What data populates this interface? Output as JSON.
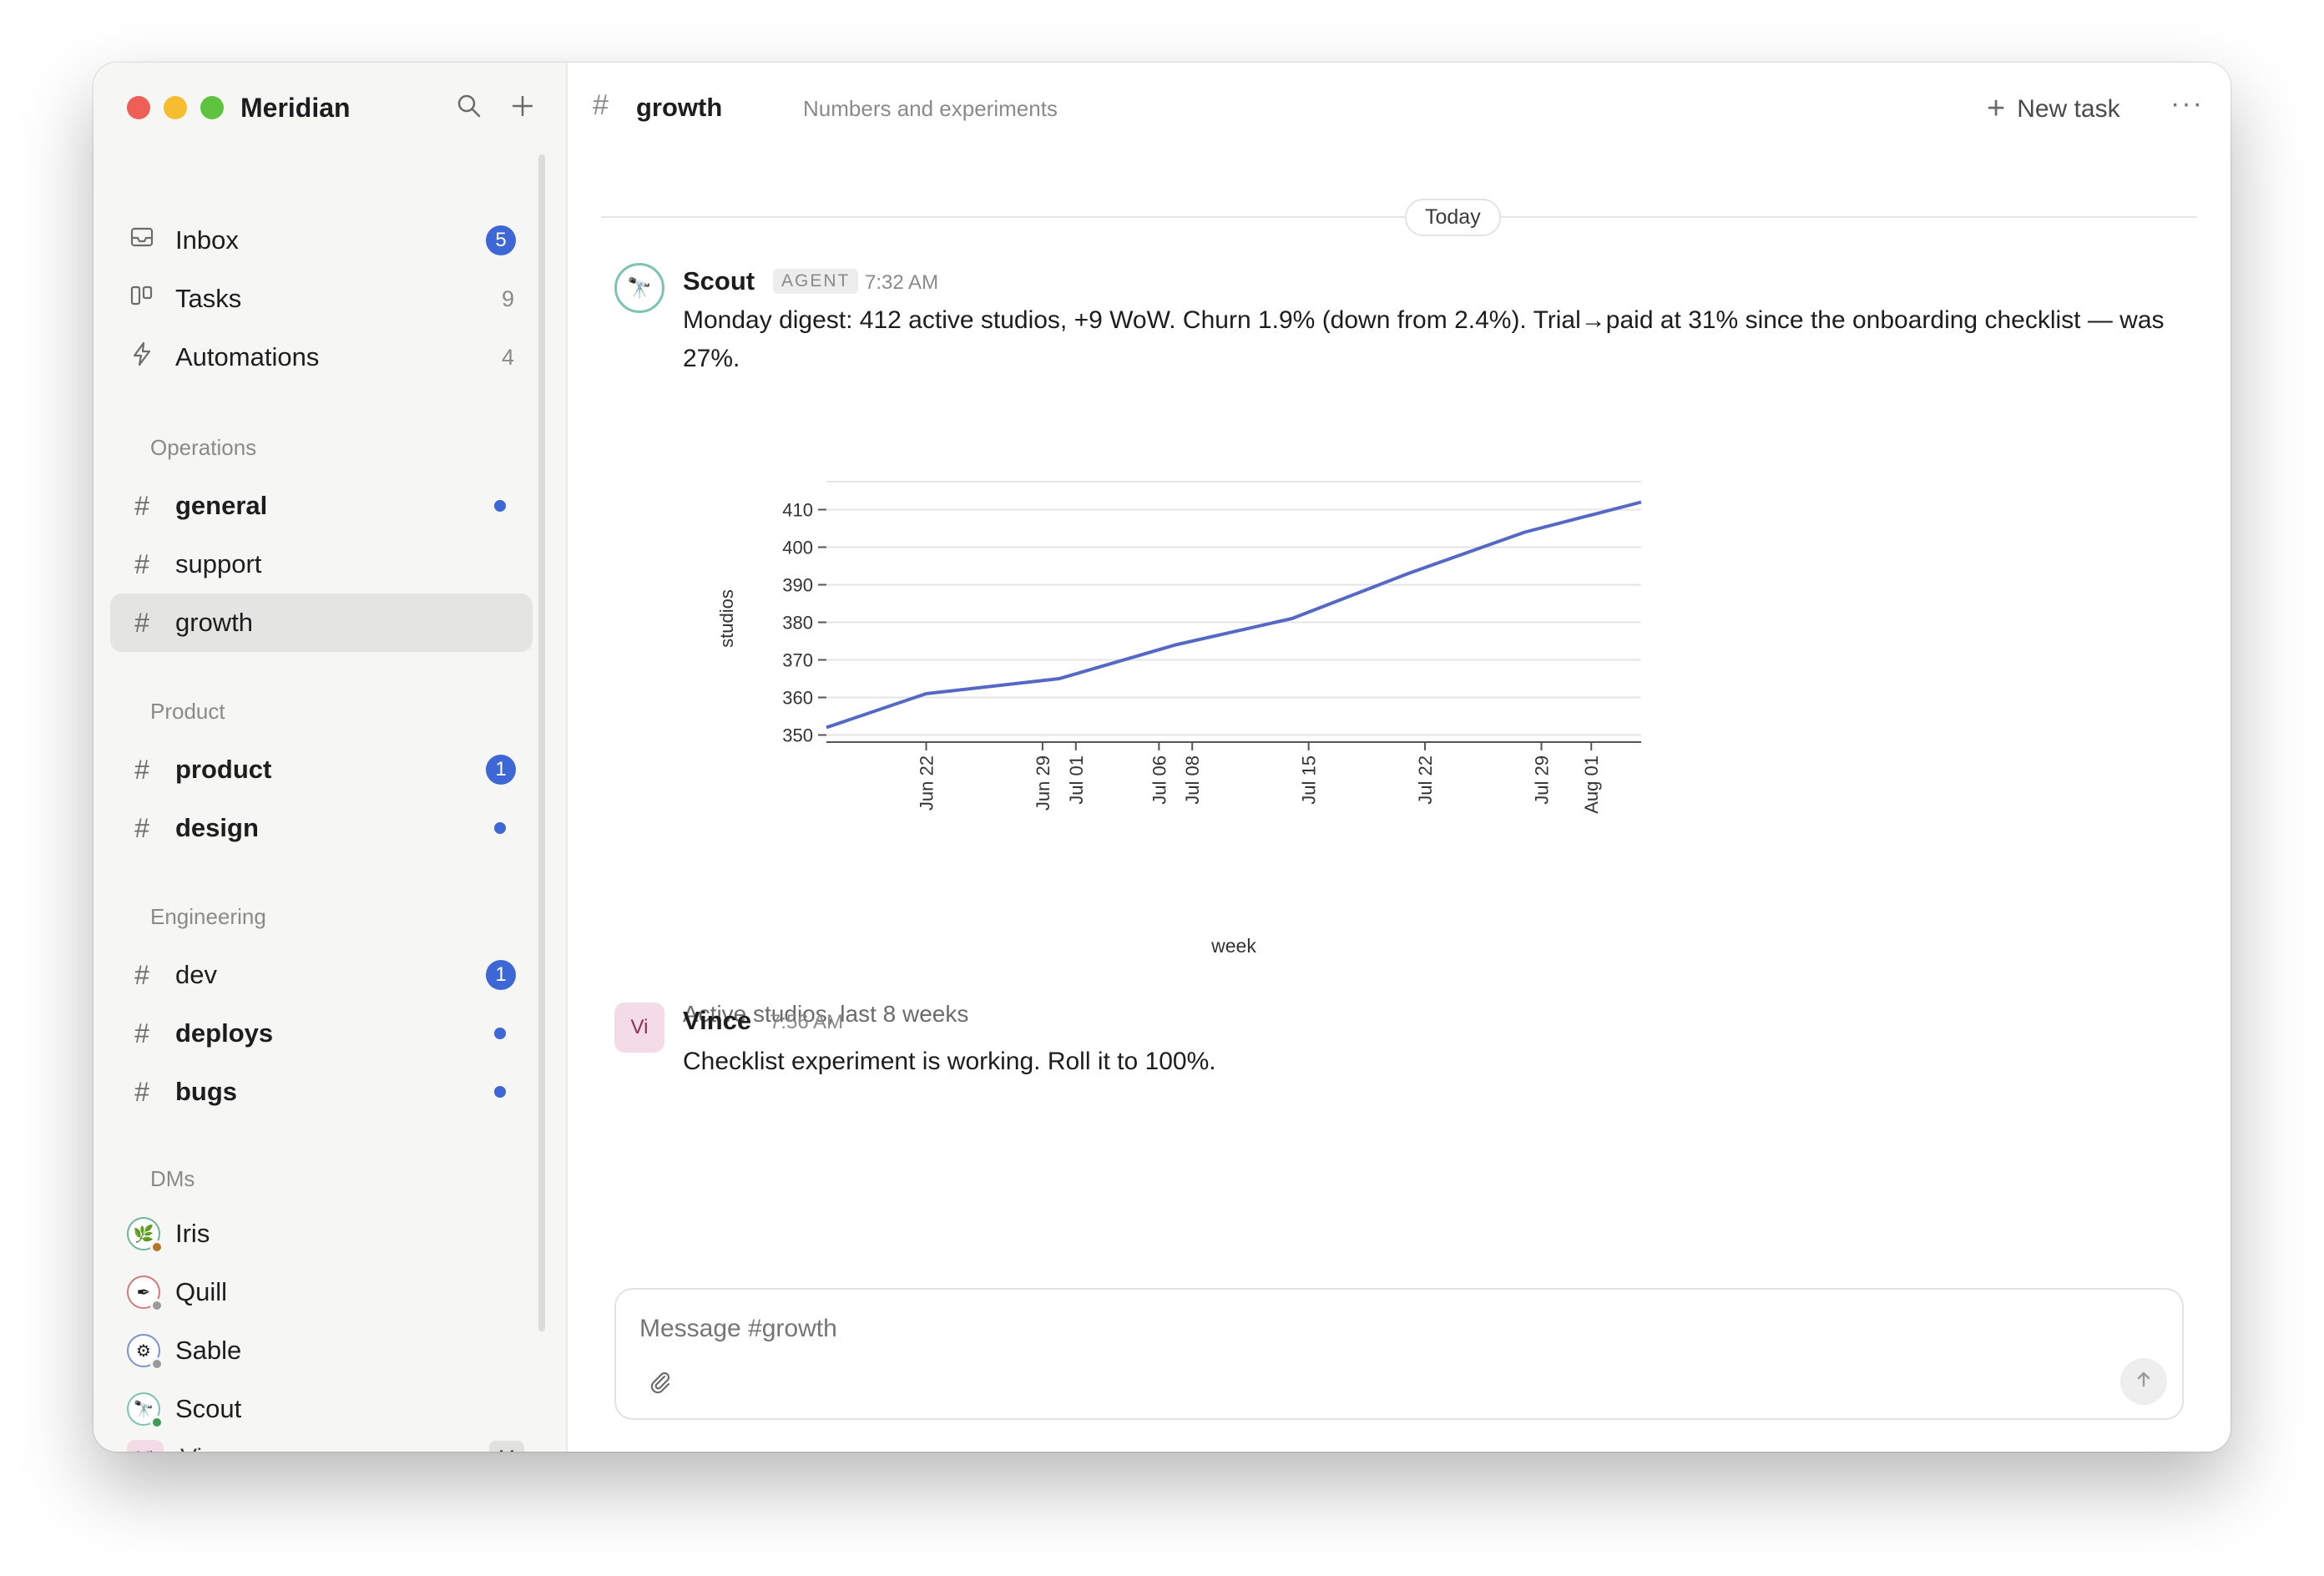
{
  "app": {
    "title": "Meridian"
  },
  "sidebar": {
    "top_items": [
      {
        "label": "Inbox",
        "badge": "5"
      },
      {
        "label": "Tasks",
        "count": "9"
      },
      {
        "label": "Automations",
        "count": "4"
      }
    ],
    "sections": {
      "operations": "Operations",
      "product": "Product",
      "engineering": "Engineering",
      "dms": "DMs"
    },
    "channels": {
      "general": "general",
      "support": "support",
      "growth": "growth",
      "product": "product",
      "product_badge": "1",
      "design": "design",
      "dev": "dev",
      "dev_badge": "1",
      "deploys": "deploys",
      "bugs": "bugs"
    },
    "dms": [
      "Iris",
      "Quill",
      "Sable",
      "Scout"
    ],
    "user": {
      "initials": "Vi",
      "name": "Vince",
      "workspace_initial": "M"
    }
  },
  "channel": {
    "hash": "#",
    "name": "growth",
    "description": "Numbers and experiments",
    "new_task_label": "New task",
    "more_label": "···"
  },
  "day_divider": "Today",
  "messages": [
    {
      "author": "Scout",
      "tag": "AGENT",
      "time": "7:32 AM",
      "text": "Monday digest: 412 active studios, +9 WoW. Churn 1.9% (down from 2.4%). Trial→paid at 31% since the onboarding checklist — was 27%.",
      "caption": "Active studios, last 8 weeks"
    },
    {
      "author": "Vince",
      "initials": "Vi",
      "time": "7:56 AM",
      "text": "Checklist experiment is working. Roll it to 100%."
    }
  ],
  "composer": {
    "placeholder": "Message #growth"
  },
  "chart_data": {
    "type": "line",
    "xlabel": "week",
    "ylabel": "studios",
    "x_ticks": [
      "Jun 22",
      "Jun 29",
      "Jul 01",
      "Jul 06",
      "Jul 08",
      "Jul 15",
      "Jul 22",
      "Jul 29",
      "Aug 01"
    ],
    "y_ticks": [
      350,
      360,
      370,
      380,
      390,
      400,
      410
    ],
    "series": [
      {
        "color": "#5468c4",
        "points": [
          {
            "x": "2024-06-16",
            "y": 352
          },
          {
            "x": "2024-06-22",
            "y": 361
          },
          {
            "x": "2024-06-30",
            "y": 365
          },
          {
            "x": "2024-07-07",
            "y": 374
          },
          {
            "x": "2024-07-14",
            "y": 381
          },
          {
            "x": "2024-07-21",
            "y": 393
          },
          {
            "x": "2024-07-28",
            "y": 404
          },
          {
            "x": "2024-08-04",
            "y": 412
          }
        ]
      }
    ],
    "ylim": [
      349,
      413
    ],
    "grid": true
  }
}
